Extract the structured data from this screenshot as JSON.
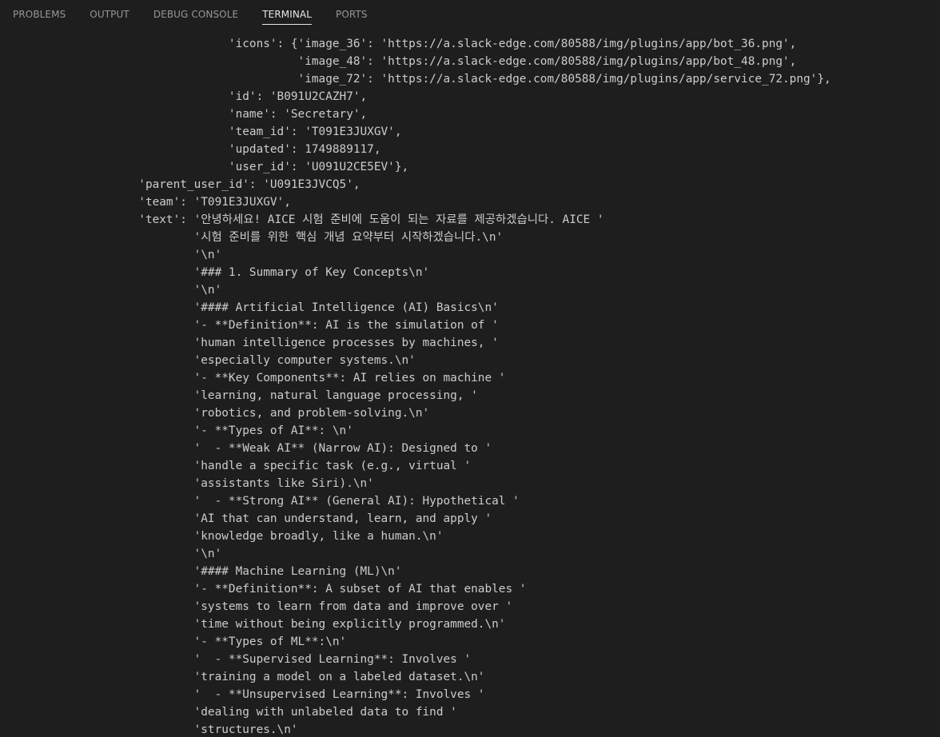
{
  "tabs": [
    {
      "label": "PROBLEMS",
      "active": false
    },
    {
      "label": "OUTPUT",
      "active": false
    },
    {
      "label": "DEBUG CONSOLE",
      "active": false
    },
    {
      "label": "TERMINAL",
      "active": true
    },
    {
      "label": "PORTS",
      "active": false
    }
  ],
  "terminal": {
    "lines": [
      "                                 'icons': {'image_36': 'https://a.slack-edge.com/80588/img/plugins/app/bot_36.png',",
      "                                           'image_48': 'https://a.slack-edge.com/80588/img/plugins/app/bot_48.png',",
      "                                           'image_72': 'https://a.slack-edge.com/80588/img/plugins/app/service_72.png'},",
      "                                 'id': 'B091U2CAZH7',",
      "                                 'name': 'Secretary',",
      "                                 'team_id': 'T091E3JUXGV',",
      "                                 'updated': 1749889117,",
      "                                 'user_id': 'U091U2CE5EV'},",
      "                    'parent_user_id': 'U091E3JVCQ5',",
      "                    'team': 'T091E3JUXGV',",
      "                    'text': '안녕하세요! AICE 시험 준비에 도움이 되는 자료를 제공하겠습니다. AICE '",
      "                            '시험 준비를 위한 핵심 개념 요약부터 시작하겠습니다.\\n'",
      "                            '\\n'",
      "                            '### 1. Summary of Key Concepts\\n'",
      "                            '\\n'",
      "                            '#### Artificial Intelligence (AI) Basics\\n'",
      "                            '- **Definition**: AI is the simulation of '",
      "                            'human intelligence processes by machines, '",
      "                            'especially computer systems.\\n'",
      "                            '- **Key Components**: AI relies on machine '",
      "                            'learning, natural language processing, '",
      "                            'robotics, and problem-solving.\\n'",
      "                            '- **Types of AI**: \\n'",
      "                            '  - **Weak AI** (Narrow AI): Designed to '",
      "                            'handle a specific task (e.g., virtual '",
      "                            'assistants like Siri).\\n'",
      "                            '  - **Strong AI** (General AI): Hypothetical '",
      "                            'AI that can understand, learn, and apply '",
      "                            'knowledge broadly, like a human.\\n'",
      "                            '\\n'",
      "                            '#### Machine Learning (ML)\\n'",
      "                            '- **Definition**: A subset of AI that enables '",
      "                            'systems to learn from data and improve over '",
      "                            'time without being explicitly programmed.\\n'",
      "                            '- **Types of ML**:\\n'",
      "                            '  - **Supervised Learning**: Involves '",
      "                            'training a model on a labeled dataset.\\n'",
      "                            '  - **Unsupervised Learning**: Involves '",
      "                            'dealing with unlabeled data to find '",
      "                            'structures.\\n'"
    ]
  },
  "colors": {
    "background": "#1e1e1e",
    "text": "#cccccc",
    "tab_inactive": "#969696",
    "tab_active": "#e7e7e7"
  }
}
